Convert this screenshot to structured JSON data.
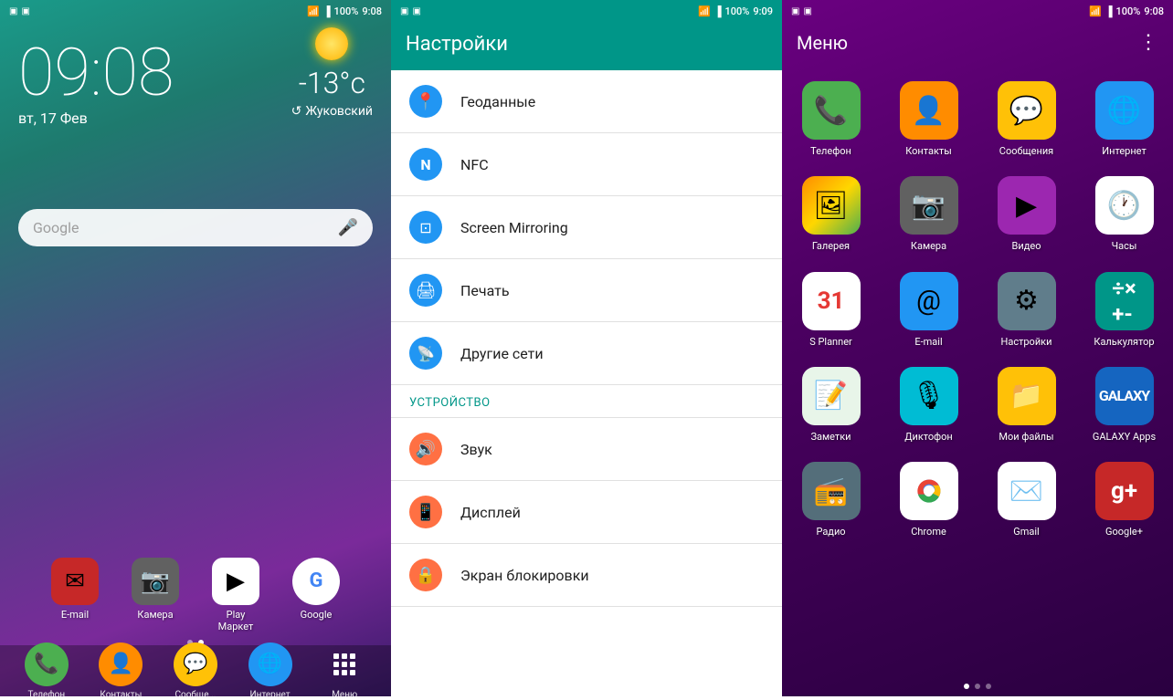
{
  "panel_home": {
    "status_bar": {
      "time": "9:08",
      "battery": "100%",
      "signal": "full"
    },
    "clock": "09:08",
    "date": "вт, 17 Фев",
    "weather": {
      "temp": "-13°c",
      "location": "Жуковский"
    },
    "search_placeholder": "Google",
    "dock_apps": [
      {
        "label": "E-mail",
        "color": "#c62828",
        "icon": "email"
      },
      {
        "label": "Камера",
        "color": "#616161",
        "icon": "camera"
      },
      {
        "label": "Play\nМаркет",
        "color": "#1565c0",
        "icon": "play"
      },
      {
        "label": "Google",
        "color": "#f5f5f5",
        "icon": "google"
      }
    ],
    "bottom_apps": [
      {
        "label": "Телефон",
        "icon": "phone",
        "color": "#4CAF50"
      },
      {
        "label": "Контакты",
        "icon": "contacts",
        "color": "#FF8C00"
      },
      {
        "label": "Сообще...",
        "icon": "messages",
        "color": "#FFC107"
      },
      {
        "label": "Интернет",
        "icon": "internet",
        "color": "#2196F3"
      },
      {
        "label": "Меню",
        "icon": "menu",
        "color": "transparent"
      }
    ]
  },
  "panel_settings": {
    "status_bar": {
      "time": "9:09",
      "battery": "100%"
    },
    "title": "Настройки",
    "items": [
      {
        "label": "Геоданные",
        "icon": "geo",
        "color": "#2196F3"
      },
      {
        "label": "NFC",
        "icon": "nfc",
        "color": "#2196F3"
      },
      {
        "label": "Screen Mirroring",
        "icon": "mirror",
        "color": "#2196F3"
      },
      {
        "label": "Печать",
        "icon": "print",
        "color": "#2196F3"
      },
      {
        "label": "Другие сети",
        "icon": "other-net",
        "color": "#2196F3"
      }
    ],
    "section_device": "УСТРОЙСТВО",
    "device_items": [
      {
        "label": "Звук",
        "icon": "sound",
        "color": "#FF7043"
      },
      {
        "label": "Дисплей",
        "icon": "display",
        "color": "#FF7043"
      },
      {
        "label": "Экран блокировки",
        "icon": "lockscreen",
        "color": "#FF7043"
      }
    ]
  },
  "panel_menu": {
    "status_bar": {
      "time": "9:08",
      "battery": "100%"
    },
    "title": "Меню",
    "more_icon": "⋮",
    "apps": [
      {
        "label": "Телефон",
        "icon": "phone",
        "color": "#4CAF50"
      },
      {
        "label": "Контакты",
        "icon": "contacts",
        "color": "#FF8C00"
      },
      {
        "label": "Сообщения",
        "icon": "messages",
        "color": "#FFC107"
      },
      {
        "label": "Интернет",
        "icon": "internet",
        "color": "#2196F3"
      },
      {
        "label": "Галерея",
        "icon": "gallery",
        "color": "#FF8C00"
      },
      {
        "label": "Камера",
        "icon": "camera",
        "color": "#9E9E9E"
      },
      {
        "label": "Видео",
        "icon": "video",
        "color": "#9C27B0"
      },
      {
        "label": "Часы",
        "icon": "clock",
        "color": "#FFFFFF"
      },
      {
        "label": "S Planner",
        "icon": "splanner",
        "color": "#FFFFFF"
      },
      {
        "label": "E-mail",
        "icon": "email2",
        "color": "#2196F3"
      },
      {
        "label": "Настройки",
        "icon": "settings",
        "color": "#607D8B"
      },
      {
        "label": "Калькулятор",
        "icon": "calc",
        "color": "#009688"
      },
      {
        "label": "Заметки",
        "icon": "notes",
        "color": "#E8F5E9"
      },
      {
        "label": "Диктофон",
        "icon": "recorder",
        "color": "#00BCD4"
      },
      {
        "label": "Мои файлы",
        "icon": "myfiles",
        "color": "#FFC107"
      },
      {
        "label": "GALAXY Apps",
        "icon": "galaxy",
        "color": "#1565C0"
      },
      {
        "label": "Радио",
        "icon": "radio",
        "color": "#546E7A"
      },
      {
        "label": "Chrome",
        "icon": "chrome",
        "color": "#FFFFFF"
      },
      {
        "label": "Gmail",
        "icon": "gmail",
        "color": "#FFFFFF"
      },
      {
        "label": "Google+",
        "icon": "googleplus",
        "color": "#C62828"
      }
    ],
    "dots": [
      {
        "active": true
      },
      {
        "active": false
      },
      {
        "active": false
      }
    ]
  }
}
